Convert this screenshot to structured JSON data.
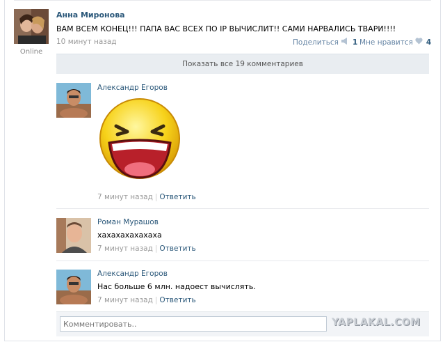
{
  "post": {
    "author": "Анна Миронова",
    "status": "Online",
    "text": "ВАМ ВСЕМ КОНЕЦ!!! ПАПА ВАС ВСЕХ ПО IP ВЫЧИСЛИТ!! САМИ НАРВАЛИСЬ ТВАРИ!!!!",
    "time": "10 минут назад",
    "share_label": "Поделиться",
    "share_count": "1",
    "like_label": "Мне нравится",
    "like_count": "4",
    "share_icon": "megaphone-icon",
    "like_icon": "heart-icon"
  },
  "show_all_label": "Показать все 19 комментариев",
  "comments": [
    {
      "author": "Александр Егоров",
      "text": "",
      "image": "laughing-smiley",
      "time": "7 минут назад",
      "reply": "Ответить"
    },
    {
      "author": "Роман Мурашов",
      "text": "хахахахахахаха",
      "time": "7 минут назад",
      "reply": "Ответить"
    },
    {
      "author": "Александр Егоров",
      "text": "Нас больше 6 млн. надоест вычислять.",
      "time": "7 минут назад",
      "reply": "Ответить"
    }
  ],
  "compose": {
    "placeholder": "Комментировать.."
  },
  "watermark": "YAPLAKAL.COM",
  "colors": {
    "link": "#2b587a",
    "muted": "#999999",
    "bar": "#e9edf1"
  }
}
